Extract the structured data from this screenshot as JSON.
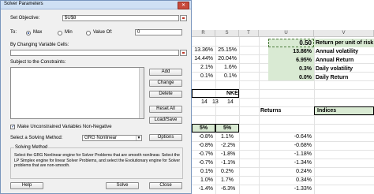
{
  "dialog": {
    "title": "Solver Parameters",
    "close_label": "✕",
    "set_objective_label": "Set Objective:",
    "objective_value": "$U$8",
    "to_label": "To:",
    "max_label": "Max",
    "min_label": "Min",
    "value_of_label": "Value Of:",
    "value_of_value": "0",
    "changing_cells_label": "By Changing Variable Cells:",
    "changing_cells_value": "",
    "constraints_label": "Subject to the Constraints:",
    "constraints": [],
    "buttons": {
      "add": "Add",
      "change": "Change",
      "delete": "Delete",
      "reset_all": "Reset All",
      "load_save": "Load/Save",
      "options": "Options",
      "help": "Help",
      "solve": "Solve",
      "close": "Close"
    },
    "unconstrained_label": "Make Unconstrained Variables Non-Negative",
    "unconstrained_checked": true,
    "method_label": "Select a Solving Method:",
    "method_value": "GRG Nonlinear",
    "solving_method_title": "Solving Method",
    "solving_method_desc": "Select the GRG Nonlinear engine for Solver Problems that are smooth nonlinear. Select the LP Simplex engine for linear Solver Problems, and select the Evolutionary engine for Solver problems that are non-smooth."
  },
  "sheet": {
    "columns": [
      "R",
      "S",
      "T",
      "U",
      "V"
    ],
    "top_rows": [
      {
        "r": "13.36%",
        "s": "25.15%"
      },
      {
        "r": "14.44%",
        "s": "20.04%"
      },
      {
        "r": "2.1%",
        "s": "1.6%"
      },
      {
        "r": "0.1%",
        "s": "0.1%"
      }
    ],
    "summary": [
      {
        "value": "0.50",
        "label": "Return per unit of risk"
      },
      {
        "value": "13.86%",
        "label": "Annual volatility"
      },
      {
        "value": "6.95%",
        "label": "Annual Return"
      },
      {
        "value": "0.3%",
        "label": "Daily volatility"
      },
      {
        "value": "0.0%",
        "label": "Daily Return"
      }
    ],
    "header_box": "NKE",
    "number_row": [
      "14",
      "13",
      "14"
    ],
    "returns_label": "Returns",
    "indices_label": "Indices",
    "pct_row": [
      "5%",
      "5%"
    ],
    "data_rows": [
      {
        "r": "-0.8%",
        "s": "1.1%",
        "u": "-0.64%"
      },
      {
        "r": "-0.8%",
        "s": "-2.2%",
        "u": "-0.68%"
      },
      {
        "r": "-0.7%",
        "s": "-1.8%",
        "u": "-1.18%"
      },
      {
        "r": "-0.7%",
        "s": "-1.1%",
        "u": "-1.34%"
      },
      {
        "r": "0.1%",
        "s": "0.2%",
        "u": "0.24%"
      },
      {
        "r": "1.0%",
        "s": "1.7%",
        "u": "0.34%"
      },
      {
        "r": "-1.4%",
        "s": "-6.3%",
        "u": "-1.33%"
      }
    ]
  }
}
